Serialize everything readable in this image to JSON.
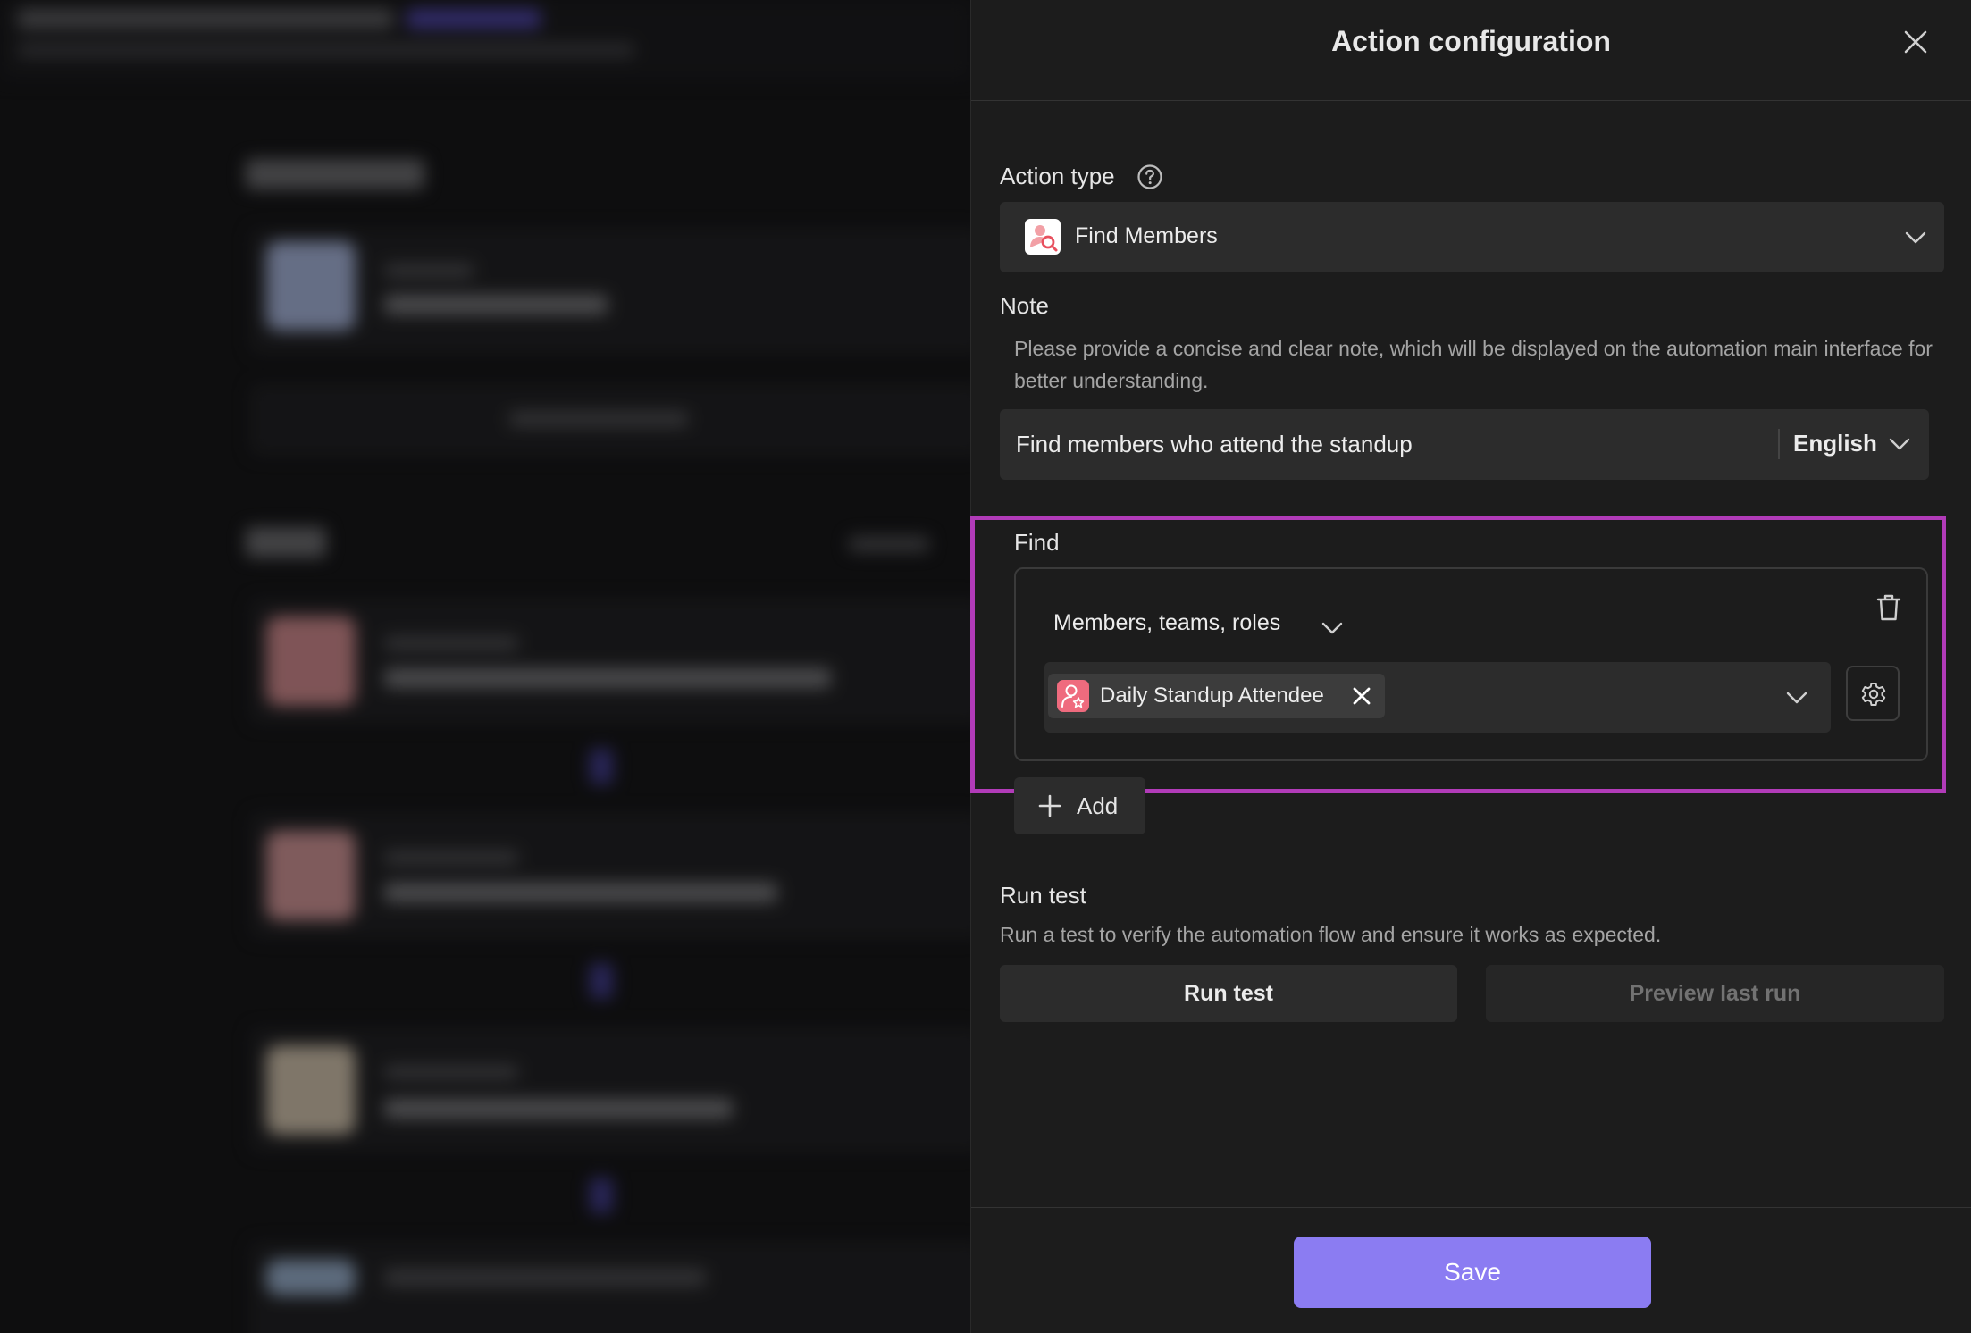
{
  "drawer": {
    "title": "Action configuration",
    "close_icon": "close-icon"
  },
  "action_type": {
    "label": "Action type",
    "help_icon": "help-circle-icon",
    "selected": "Find Members",
    "selected_icon": "find-members-icon"
  },
  "note": {
    "label": "Note",
    "description": "Please provide a concise and clear note, which will be displayed on the automation main interface for better understanding.",
    "value": "Find members who attend the standup",
    "language": "English"
  },
  "find": {
    "label": "Find",
    "scope": "Members, teams, roles",
    "tag_label": "Daily Standup Attendee",
    "tag_icon": "role-icon",
    "delete_icon": "trash-icon",
    "settings_icon": "gear-icon",
    "add_label": "Add"
  },
  "run_test": {
    "label": "Run test",
    "description": "Run a test to verify the automation flow and ensure it works as expected.",
    "run_button": "Run test",
    "preview_button": "Preview last run"
  },
  "footer": {
    "save_label": "Save"
  },
  "colors": {
    "accent": "#8b7cf2",
    "highlight": "#b13bb8",
    "tag_avatar": "#ef6b7e"
  }
}
